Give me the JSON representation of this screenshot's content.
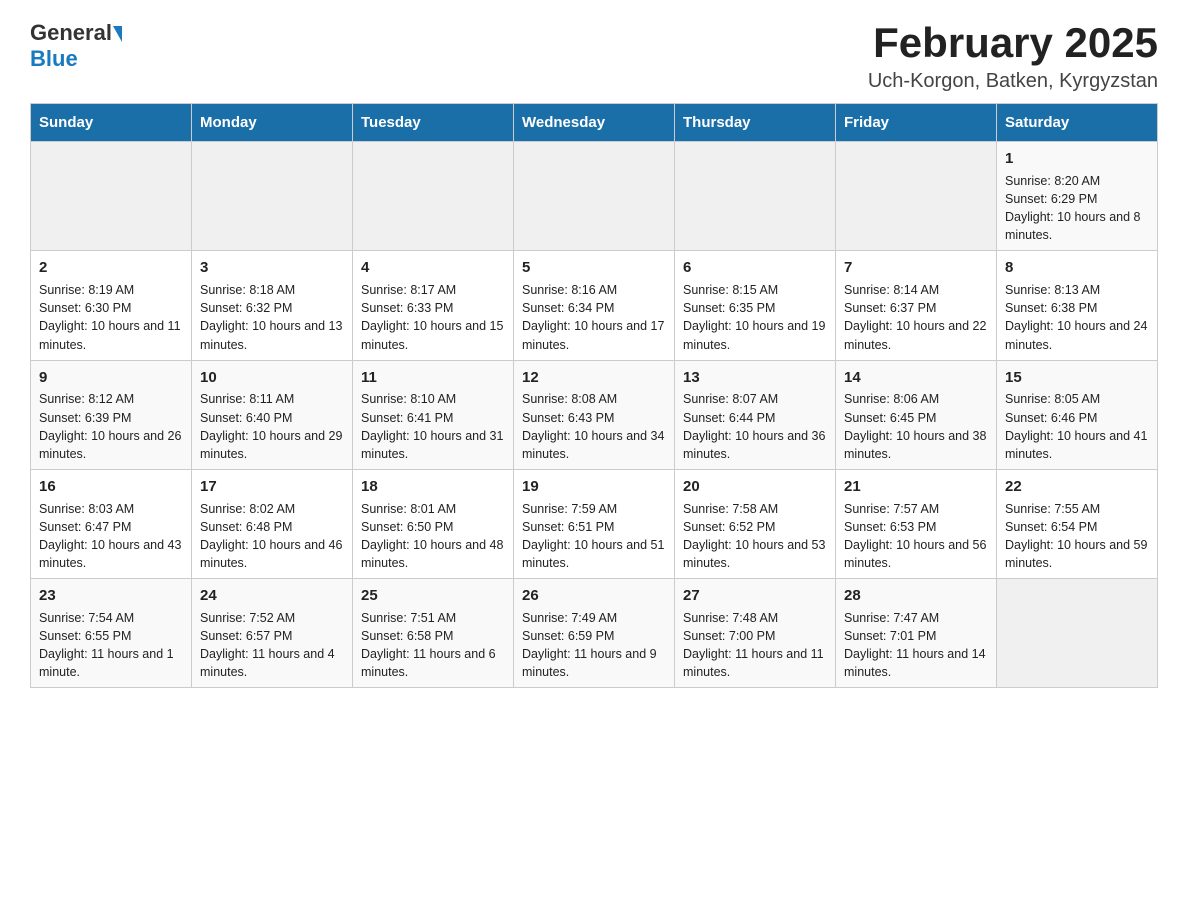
{
  "header": {
    "month_title": "February 2025",
    "location": "Uch-Korgon, Batken, Kyrgyzstan",
    "logo_general": "General",
    "logo_blue": "Blue"
  },
  "days_of_week": [
    "Sunday",
    "Monday",
    "Tuesday",
    "Wednesday",
    "Thursday",
    "Friday",
    "Saturday"
  ],
  "weeks": [
    {
      "days": [
        {
          "number": "",
          "info": ""
        },
        {
          "number": "",
          "info": ""
        },
        {
          "number": "",
          "info": ""
        },
        {
          "number": "",
          "info": ""
        },
        {
          "number": "",
          "info": ""
        },
        {
          "number": "",
          "info": ""
        },
        {
          "number": "1",
          "info": "Sunrise: 8:20 AM\nSunset: 6:29 PM\nDaylight: 10 hours and 8 minutes."
        }
      ]
    },
    {
      "days": [
        {
          "number": "2",
          "info": "Sunrise: 8:19 AM\nSunset: 6:30 PM\nDaylight: 10 hours and 11 minutes."
        },
        {
          "number": "3",
          "info": "Sunrise: 8:18 AM\nSunset: 6:32 PM\nDaylight: 10 hours and 13 minutes."
        },
        {
          "number": "4",
          "info": "Sunrise: 8:17 AM\nSunset: 6:33 PM\nDaylight: 10 hours and 15 minutes."
        },
        {
          "number": "5",
          "info": "Sunrise: 8:16 AM\nSunset: 6:34 PM\nDaylight: 10 hours and 17 minutes."
        },
        {
          "number": "6",
          "info": "Sunrise: 8:15 AM\nSunset: 6:35 PM\nDaylight: 10 hours and 19 minutes."
        },
        {
          "number": "7",
          "info": "Sunrise: 8:14 AM\nSunset: 6:37 PM\nDaylight: 10 hours and 22 minutes."
        },
        {
          "number": "8",
          "info": "Sunrise: 8:13 AM\nSunset: 6:38 PM\nDaylight: 10 hours and 24 minutes."
        }
      ]
    },
    {
      "days": [
        {
          "number": "9",
          "info": "Sunrise: 8:12 AM\nSunset: 6:39 PM\nDaylight: 10 hours and 26 minutes."
        },
        {
          "number": "10",
          "info": "Sunrise: 8:11 AM\nSunset: 6:40 PM\nDaylight: 10 hours and 29 minutes."
        },
        {
          "number": "11",
          "info": "Sunrise: 8:10 AM\nSunset: 6:41 PM\nDaylight: 10 hours and 31 minutes."
        },
        {
          "number": "12",
          "info": "Sunrise: 8:08 AM\nSunset: 6:43 PM\nDaylight: 10 hours and 34 minutes."
        },
        {
          "number": "13",
          "info": "Sunrise: 8:07 AM\nSunset: 6:44 PM\nDaylight: 10 hours and 36 minutes."
        },
        {
          "number": "14",
          "info": "Sunrise: 8:06 AM\nSunset: 6:45 PM\nDaylight: 10 hours and 38 minutes."
        },
        {
          "number": "15",
          "info": "Sunrise: 8:05 AM\nSunset: 6:46 PM\nDaylight: 10 hours and 41 minutes."
        }
      ]
    },
    {
      "days": [
        {
          "number": "16",
          "info": "Sunrise: 8:03 AM\nSunset: 6:47 PM\nDaylight: 10 hours and 43 minutes."
        },
        {
          "number": "17",
          "info": "Sunrise: 8:02 AM\nSunset: 6:48 PM\nDaylight: 10 hours and 46 minutes."
        },
        {
          "number": "18",
          "info": "Sunrise: 8:01 AM\nSunset: 6:50 PM\nDaylight: 10 hours and 48 minutes."
        },
        {
          "number": "19",
          "info": "Sunrise: 7:59 AM\nSunset: 6:51 PM\nDaylight: 10 hours and 51 minutes."
        },
        {
          "number": "20",
          "info": "Sunrise: 7:58 AM\nSunset: 6:52 PM\nDaylight: 10 hours and 53 minutes."
        },
        {
          "number": "21",
          "info": "Sunrise: 7:57 AM\nSunset: 6:53 PM\nDaylight: 10 hours and 56 minutes."
        },
        {
          "number": "22",
          "info": "Sunrise: 7:55 AM\nSunset: 6:54 PM\nDaylight: 10 hours and 59 minutes."
        }
      ]
    },
    {
      "days": [
        {
          "number": "23",
          "info": "Sunrise: 7:54 AM\nSunset: 6:55 PM\nDaylight: 11 hours and 1 minute."
        },
        {
          "number": "24",
          "info": "Sunrise: 7:52 AM\nSunset: 6:57 PM\nDaylight: 11 hours and 4 minutes."
        },
        {
          "number": "25",
          "info": "Sunrise: 7:51 AM\nSunset: 6:58 PM\nDaylight: 11 hours and 6 minutes."
        },
        {
          "number": "26",
          "info": "Sunrise: 7:49 AM\nSunset: 6:59 PM\nDaylight: 11 hours and 9 minutes."
        },
        {
          "number": "27",
          "info": "Sunrise: 7:48 AM\nSunset: 7:00 PM\nDaylight: 11 hours and 11 minutes."
        },
        {
          "number": "28",
          "info": "Sunrise: 7:47 AM\nSunset: 7:01 PM\nDaylight: 11 hours and 14 minutes."
        },
        {
          "number": "",
          "info": ""
        }
      ]
    }
  ]
}
